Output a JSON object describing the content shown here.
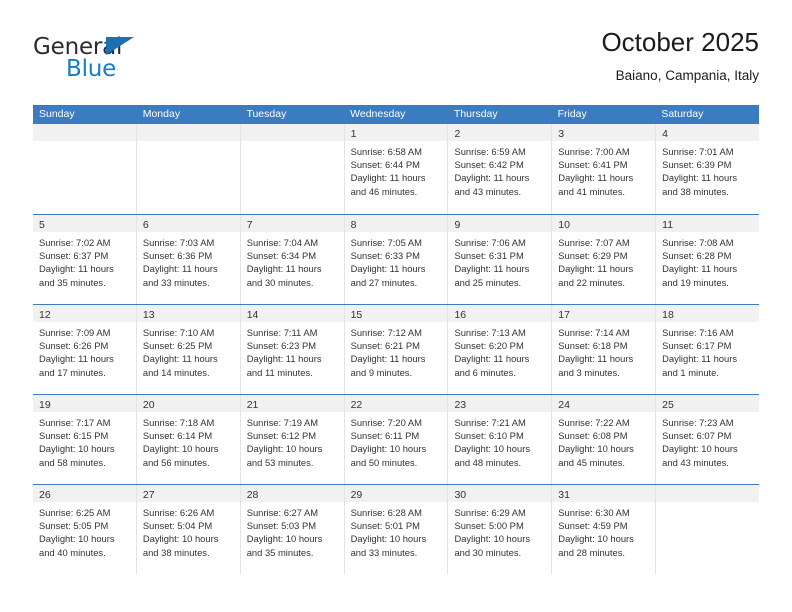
{
  "brand": {
    "name_part1": "General",
    "name_part2": "Blue",
    "accent_color": "#1a7cc4",
    "triangle_color": "#1f6fb5"
  },
  "header": {
    "title": "October 2025",
    "subtitle": "Baiano, Campania, Italy"
  },
  "calendar": {
    "header_bg": "#3b7cc0",
    "weekdays": [
      "Sunday",
      "Monday",
      "Tuesday",
      "Wednesday",
      "Thursday",
      "Friday",
      "Saturday"
    ],
    "weeks": [
      [
        {
          "day": "",
          "sunrise": "",
          "sunset": "",
          "daylight": "",
          "empty": true
        },
        {
          "day": "",
          "sunrise": "",
          "sunset": "",
          "daylight": "",
          "empty": true
        },
        {
          "day": "",
          "sunrise": "",
          "sunset": "",
          "daylight": "",
          "empty": true
        },
        {
          "day": "1",
          "sunrise": "Sunrise: 6:58 AM",
          "sunset": "Sunset: 6:44 PM",
          "daylight": "Daylight: 11 hours and 46 minutes.",
          "empty": false
        },
        {
          "day": "2",
          "sunrise": "Sunrise: 6:59 AM",
          "sunset": "Sunset: 6:42 PM",
          "daylight": "Daylight: 11 hours and 43 minutes.",
          "empty": false
        },
        {
          "day": "3",
          "sunrise": "Sunrise: 7:00 AM",
          "sunset": "Sunset: 6:41 PM",
          "daylight": "Daylight: 11 hours and 41 minutes.",
          "empty": false
        },
        {
          "day": "4",
          "sunrise": "Sunrise: 7:01 AM",
          "sunset": "Sunset: 6:39 PM",
          "daylight": "Daylight: 11 hours and 38 minutes.",
          "empty": false
        }
      ],
      [
        {
          "day": "5",
          "sunrise": "Sunrise: 7:02 AM",
          "sunset": "Sunset: 6:37 PM",
          "daylight": "Daylight: 11 hours and 35 minutes.",
          "empty": false
        },
        {
          "day": "6",
          "sunrise": "Sunrise: 7:03 AM",
          "sunset": "Sunset: 6:36 PM",
          "daylight": "Daylight: 11 hours and 33 minutes.",
          "empty": false
        },
        {
          "day": "7",
          "sunrise": "Sunrise: 7:04 AM",
          "sunset": "Sunset: 6:34 PM",
          "daylight": "Daylight: 11 hours and 30 minutes.",
          "empty": false
        },
        {
          "day": "8",
          "sunrise": "Sunrise: 7:05 AM",
          "sunset": "Sunset: 6:33 PM",
          "daylight": "Daylight: 11 hours and 27 minutes.",
          "empty": false
        },
        {
          "day": "9",
          "sunrise": "Sunrise: 7:06 AM",
          "sunset": "Sunset: 6:31 PM",
          "daylight": "Daylight: 11 hours and 25 minutes.",
          "empty": false
        },
        {
          "day": "10",
          "sunrise": "Sunrise: 7:07 AM",
          "sunset": "Sunset: 6:29 PM",
          "daylight": "Daylight: 11 hours and 22 minutes.",
          "empty": false
        },
        {
          "day": "11",
          "sunrise": "Sunrise: 7:08 AM",
          "sunset": "Sunset: 6:28 PM",
          "daylight": "Daylight: 11 hours and 19 minutes.",
          "empty": false
        }
      ],
      [
        {
          "day": "12",
          "sunrise": "Sunrise: 7:09 AM",
          "sunset": "Sunset: 6:26 PM",
          "daylight": "Daylight: 11 hours and 17 minutes.",
          "empty": false
        },
        {
          "day": "13",
          "sunrise": "Sunrise: 7:10 AM",
          "sunset": "Sunset: 6:25 PM",
          "daylight": "Daylight: 11 hours and 14 minutes.",
          "empty": false
        },
        {
          "day": "14",
          "sunrise": "Sunrise: 7:11 AM",
          "sunset": "Sunset: 6:23 PM",
          "daylight": "Daylight: 11 hours and 11 minutes.",
          "empty": false
        },
        {
          "day": "15",
          "sunrise": "Sunrise: 7:12 AM",
          "sunset": "Sunset: 6:21 PM",
          "daylight": "Daylight: 11 hours and 9 minutes.",
          "empty": false
        },
        {
          "day": "16",
          "sunrise": "Sunrise: 7:13 AM",
          "sunset": "Sunset: 6:20 PM",
          "daylight": "Daylight: 11 hours and 6 minutes.",
          "empty": false
        },
        {
          "day": "17",
          "sunrise": "Sunrise: 7:14 AM",
          "sunset": "Sunset: 6:18 PM",
          "daylight": "Daylight: 11 hours and 3 minutes.",
          "empty": false
        },
        {
          "day": "18",
          "sunrise": "Sunrise: 7:16 AM",
          "sunset": "Sunset: 6:17 PM",
          "daylight": "Daylight: 11 hours and 1 minute.",
          "empty": false
        }
      ],
      [
        {
          "day": "19",
          "sunrise": "Sunrise: 7:17 AM",
          "sunset": "Sunset: 6:15 PM",
          "daylight": "Daylight: 10 hours and 58 minutes.",
          "empty": false
        },
        {
          "day": "20",
          "sunrise": "Sunrise: 7:18 AM",
          "sunset": "Sunset: 6:14 PM",
          "daylight": "Daylight: 10 hours and 56 minutes.",
          "empty": false
        },
        {
          "day": "21",
          "sunrise": "Sunrise: 7:19 AM",
          "sunset": "Sunset: 6:12 PM",
          "daylight": "Daylight: 10 hours and 53 minutes.",
          "empty": false
        },
        {
          "day": "22",
          "sunrise": "Sunrise: 7:20 AM",
          "sunset": "Sunset: 6:11 PM",
          "daylight": "Daylight: 10 hours and 50 minutes.",
          "empty": false
        },
        {
          "day": "23",
          "sunrise": "Sunrise: 7:21 AM",
          "sunset": "Sunset: 6:10 PM",
          "daylight": "Daylight: 10 hours and 48 minutes.",
          "empty": false
        },
        {
          "day": "24",
          "sunrise": "Sunrise: 7:22 AM",
          "sunset": "Sunset: 6:08 PM",
          "daylight": "Daylight: 10 hours and 45 minutes.",
          "empty": false
        },
        {
          "day": "25",
          "sunrise": "Sunrise: 7:23 AM",
          "sunset": "Sunset: 6:07 PM",
          "daylight": "Daylight: 10 hours and 43 minutes.",
          "empty": false
        }
      ],
      [
        {
          "day": "26",
          "sunrise": "Sunrise: 6:25 AM",
          "sunset": "Sunset: 5:05 PM",
          "daylight": "Daylight: 10 hours and 40 minutes.",
          "empty": false
        },
        {
          "day": "27",
          "sunrise": "Sunrise: 6:26 AM",
          "sunset": "Sunset: 5:04 PM",
          "daylight": "Daylight: 10 hours and 38 minutes.",
          "empty": false
        },
        {
          "day": "28",
          "sunrise": "Sunrise: 6:27 AM",
          "sunset": "Sunset: 5:03 PM",
          "daylight": "Daylight: 10 hours and 35 minutes.",
          "empty": false
        },
        {
          "day": "29",
          "sunrise": "Sunrise: 6:28 AM",
          "sunset": "Sunset: 5:01 PM",
          "daylight": "Daylight: 10 hours and 33 minutes.",
          "empty": false
        },
        {
          "day": "30",
          "sunrise": "Sunrise: 6:29 AM",
          "sunset": "Sunset: 5:00 PM",
          "daylight": "Daylight: 10 hours and 30 minutes.",
          "empty": false
        },
        {
          "day": "31",
          "sunrise": "Sunrise: 6:30 AM",
          "sunset": "Sunset: 4:59 PM",
          "daylight": "Daylight: 10 hours and 28 minutes.",
          "empty": false
        },
        {
          "day": "",
          "sunrise": "",
          "sunset": "",
          "daylight": "",
          "empty": true
        }
      ]
    ]
  }
}
